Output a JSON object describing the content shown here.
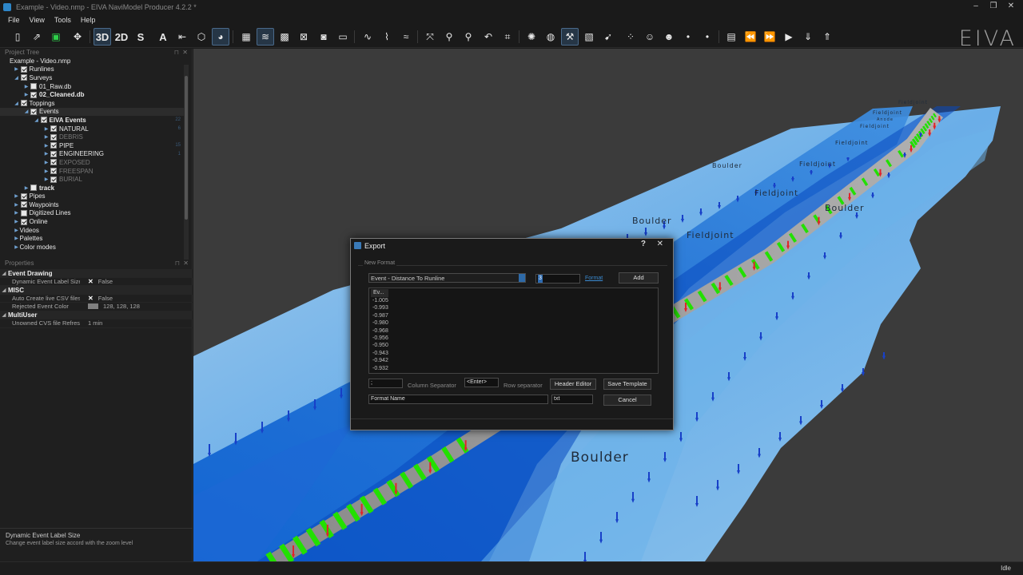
{
  "window": {
    "title": "Example - Video.nmp - EIVA NaviModel Producer 4.2.2 *",
    "brand": "EIVA"
  },
  "menu": [
    "File",
    "View",
    "Tools",
    "Help"
  ],
  "toolbar": {
    "view_3d": "3D",
    "view_2d": "2D",
    "view_s": "S",
    "annot_a": "A"
  },
  "project_tree": {
    "title": "Project Tree",
    "items": [
      {
        "label": "Example - Video.nmp",
        "indent": 0,
        "arrow": "",
        "checkbox": "none"
      },
      {
        "label": "Runlines",
        "indent": 1,
        "arrow": "▶",
        "checkbox": "checked"
      },
      {
        "label": "Surveys",
        "indent": 1,
        "arrow": "◢",
        "checkbox": "checked"
      },
      {
        "label": "01_Raw.db",
        "indent": 2,
        "arrow": "▶",
        "checkbox": "unchecked"
      },
      {
        "label": "02_Cleaned.db",
        "indent": 2,
        "arrow": "▶",
        "checkbox": "checked",
        "bold": true
      },
      {
        "label": "Toppings",
        "indent": 1,
        "arrow": "◢",
        "checkbox": "checked"
      },
      {
        "label": "Events",
        "indent": 2,
        "arrow": "◢",
        "checkbox": "checked",
        "selected": true
      },
      {
        "label": "EIVA Events",
        "indent": 3,
        "arrow": "◢",
        "checkbox": "checked",
        "bold": true,
        "count": "22"
      },
      {
        "label": "NATURAL",
        "indent": 4,
        "arrow": "▶",
        "checkbox": "checked",
        "count": "6"
      },
      {
        "label": "DEBRIS",
        "indent": 4,
        "arrow": "▶",
        "checkbox": "checked",
        "dim": true
      },
      {
        "label": "PIPE",
        "indent": 4,
        "arrow": "▶",
        "checkbox": "checked",
        "count": "15"
      },
      {
        "label": "ENGINEERING",
        "indent": 4,
        "arrow": "▶",
        "checkbox": "checked",
        "count": "1"
      },
      {
        "label": "EXPOSED",
        "indent": 4,
        "arrow": "▶",
        "checkbox": "checked",
        "dim": true
      },
      {
        "label": "FREESPAN",
        "indent": 4,
        "arrow": "▶",
        "checkbox": "checked",
        "dim": true
      },
      {
        "label": "BURIAL",
        "indent": 4,
        "arrow": "▶",
        "checkbox": "checked",
        "dim": true
      },
      {
        "label": "track",
        "indent": 2,
        "arrow": "▶",
        "checkbox": "unchecked",
        "bold": true
      },
      {
        "label": "Pipes",
        "indent": 1,
        "arrow": "▶",
        "checkbox": "checked"
      },
      {
        "label": "Waypoints",
        "indent": 1,
        "arrow": "▶",
        "checkbox": "checked"
      },
      {
        "label": "Digitized Lines",
        "indent": 1,
        "arrow": "▶",
        "checkbox": "unchecked"
      },
      {
        "label": "Online",
        "indent": 1,
        "arrow": "▶",
        "checkbox": "checked"
      },
      {
        "label": "Videos",
        "indent": 1,
        "arrow": "▶",
        "checkbox": "none"
      },
      {
        "label": "Palettes",
        "indent": 1,
        "arrow": "▶",
        "checkbox": "none"
      },
      {
        "label": "Color modes",
        "indent": 1,
        "arrow": "▶",
        "checkbox": "none"
      }
    ]
  },
  "properties": {
    "title": "Properties",
    "groups": [
      {
        "name": "Event Drawing",
        "props": [
          {
            "name": "Dynamic Event Label Size",
            "value": "False",
            "mark": "✕"
          }
        ]
      },
      {
        "name": "MISC",
        "props": [
          {
            "name": "Auto Create live CSV files",
            "value": "False",
            "mark": "✕"
          },
          {
            "name": "Rejected Event Color",
            "value": "128, 128, 128",
            "swatch": "#808080"
          }
        ]
      },
      {
        "name": "MultiUser",
        "props": [
          {
            "name": "Unowned CVS file Refresh b",
            "value": "1 min"
          }
        ]
      }
    ]
  },
  "description": {
    "title": "Dynamic Event Label Size",
    "text": "Change event label size accord with the zoom level"
  },
  "scene_labels": {
    "boulder_big": "Boulder",
    "boulder_mid": "Boulder",
    "boulder_left": "Boulder",
    "fieldjoint_1": "Fieldjoint",
    "fieldjoint_2": "Fieldjoint",
    "fieldjoint_3": "Fieldjoint",
    "fieldjoint_4": "Fieldjoint",
    "fieldjoint_5": "Fieldjoint",
    "fieldjoint_6": "Fieldjoint",
    "fieldjoint_7": "Fieldjoint",
    "anode": "Anode",
    "boulder_small": "Boulder"
  },
  "dialog": {
    "title": "Export",
    "help": "?",
    "close": "✕",
    "group_label": "New Format",
    "combo_value": "Event - Distance To Runline",
    "number_value": "3",
    "format_link": "Format",
    "add_button": "Add",
    "preview_header": "Ev...",
    "preview_values": [
      "-1.005",
      "-0.993",
      "-0.987",
      "-0.980",
      "-0.968",
      "-0.956",
      "-0.950",
      "-0.943",
      "-0.942",
      "-0.932"
    ],
    "column_separator_value": ";",
    "column_separator_label": "Column Separator",
    "row_separator_value": "<Enter>",
    "row_separator_label": "Row separator",
    "header_editor_button": "Header Editor",
    "save_template_button": "Save Template",
    "format_name_value": "Format Name",
    "extension_value": "txt",
    "cancel_button": "Cancel"
  },
  "status": {
    "state": "Idle"
  },
  "colors": {
    "accent": "#2e6aa8",
    "pipe_green": "#22e000",
    "seabed_blue": "#3a7fd0",
    "marker_red": "#e0242a",
    "marker_blue": "#1840c8"
  }
}
